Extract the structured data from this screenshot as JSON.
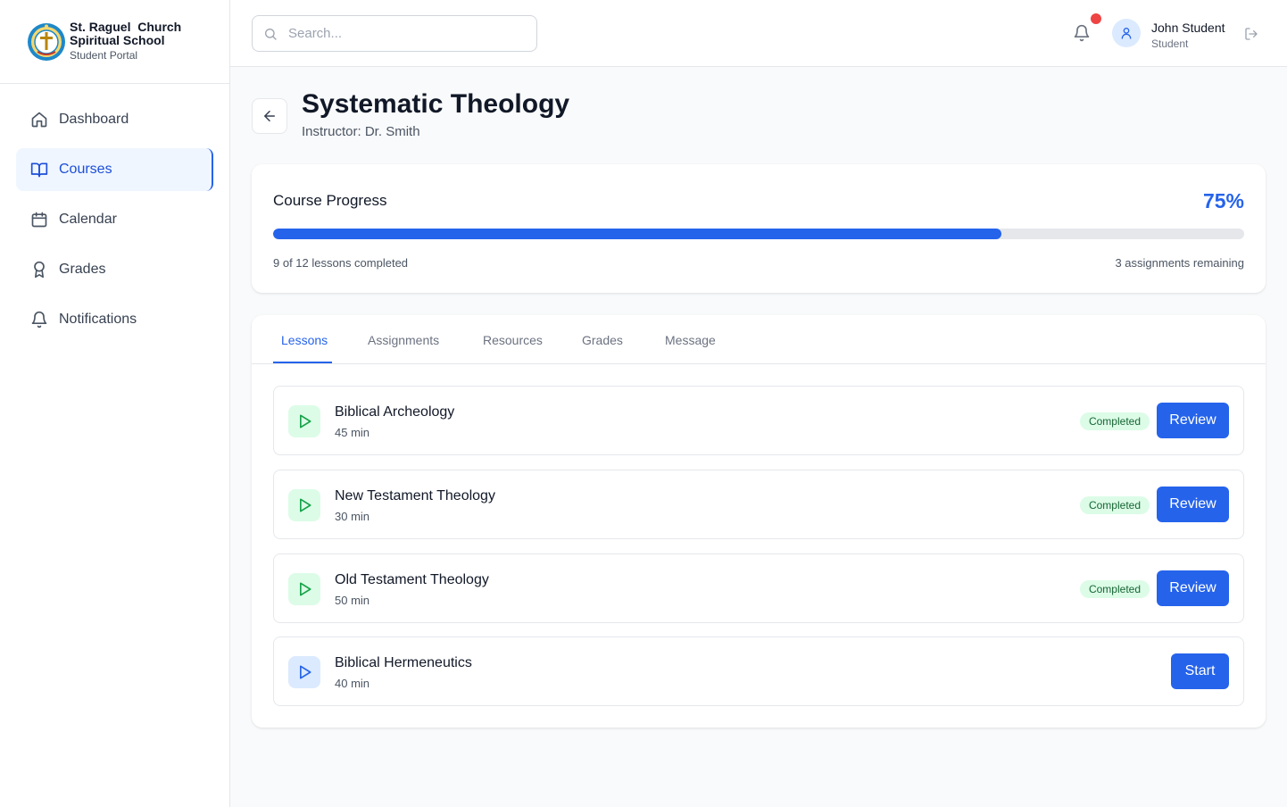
{
  "brand": {
    "line1": "St. Raguel  Church",
    "line2": "Spiritual School",
    "subtitle": "Student Portal"
  },
  "sidebar": {
    "items": [
      {
        "label": "Dashboard",
        "icon": "home-icon",
        "active": false
      },
      {
        "label": "Courses",
        "icon": "book-open-icon",
        "active": true
      },
      {
        "label": "Calendar",
        "icon": "calendar-icon",
        "active": false
      },
      {
        "label": "Grades",
        "icon": "award-icon",
        "active": false
      },
      {
        "label": "Notifications",
        "icon": "bell-icon",
        "active": false
      }
    ]
  },
  "header": {
    "search_placeholder": "Search...",
    "has_unread_notification": true,
    "user_name": "John Student",
    "user_role": "Student"
  },
  "course": {
    "title": "Systematic Theology",
    "instructor": "Instructor: Dr. Smith"
  },
  "progress": {
    "title": "Course Progress",
    "percent_label": "75%",
    "percent": 75,
    "lessons_completed_text": "9 of 12 lessons completed",
    "assignments_remaining_text": "3 assignments remaining"
  },
  "tabs": [
    {
      "label": "Lessons",
      "active": true
    },
    {
      "label": "Assignments",
      "active": false
    },
    {
      "label": "Resources",
      "active": false
    },
    {
      "label": "Grades",
      "active": false
    },
    {
      "label": "Message",
      "active": false
    }
  ],
  "lessons": [
    {
      "title": "Biblical Archeology",
      "duration": "45 min",
      "status": "Completed",
      "action": "Review"
    },
    {
      "title": "New Testament Theology",
      "duration": "30 min",
      "status": "Completed",
      "action": "Review"
    },
    {
      "title": "Old Testament Theology",
      "duration": "50 min",
      "status": "Completed",
      "action": "Review"
    },
    {
      "title": "Biblical Hermeneutics",
      "duration": "40 min",
      "status": "",
      "action": "Start"
    }
  ],
  "colors": {
    "accent": "#2563eb",
    "completed_bg": "#dcfce7",
    "completed_text": "#166534",
    "notification_dot": "#ef4444"
  }
}
